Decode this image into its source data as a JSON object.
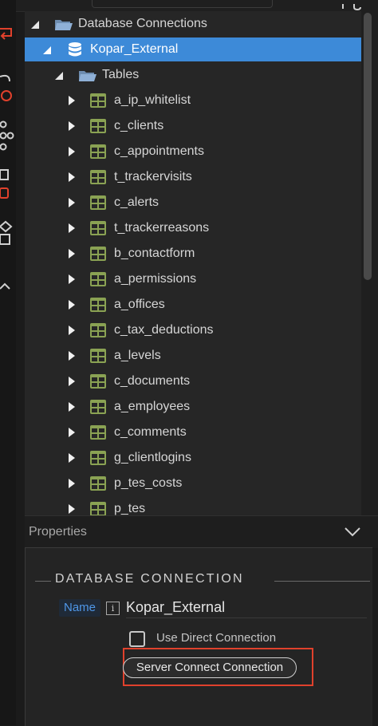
{
  "tree": {
    "root_label": "Database Connections",
    "connection_label": "Kopar_External",
    "tables_label": "Tables",
    "tables": [
      "a_ip_whitelist",
      "c_clients",
      "c_appointments",
      "t_trackervisits",
      "c_alerts",
      "t_trackerreasons",
      "b_contactform",
      "a_permissions",
      "a_offices",
      "c_tax_deductions",
      "a_levels",
      "c_documents",
      "a_employees",
      "c_comments",
      "g_clientlogins",
      "p_tes_costs",
      "p_tes"
    ]
  },
  "properties": {
    "title": "Properties",
    "section_title": "DATABASE CONNECTION",
    "name_label": "Name",
    "info_symbol": "i",
    "name_value": "Kopar_External",
    "use_direct_label": "Use Direct Connection",
    "use_direct_checked": false,
    "server_connect_label": "Server Connect Connection"
  },
  "colors": {
    "selection": "#3d8ad8",
    "table_icon": "#8aa253",
    "highlight_outline": "#e0412c",
    "name_label_text": "#4f97e8"
  },
  "icons": [
    "folder-icon",
    "database-icon",
    "table-icon",
    "expand-arrow-icon",
    "collapse-arrow-icon",
    "chevron-down-icon",
    "info-icon"
  ]
}
